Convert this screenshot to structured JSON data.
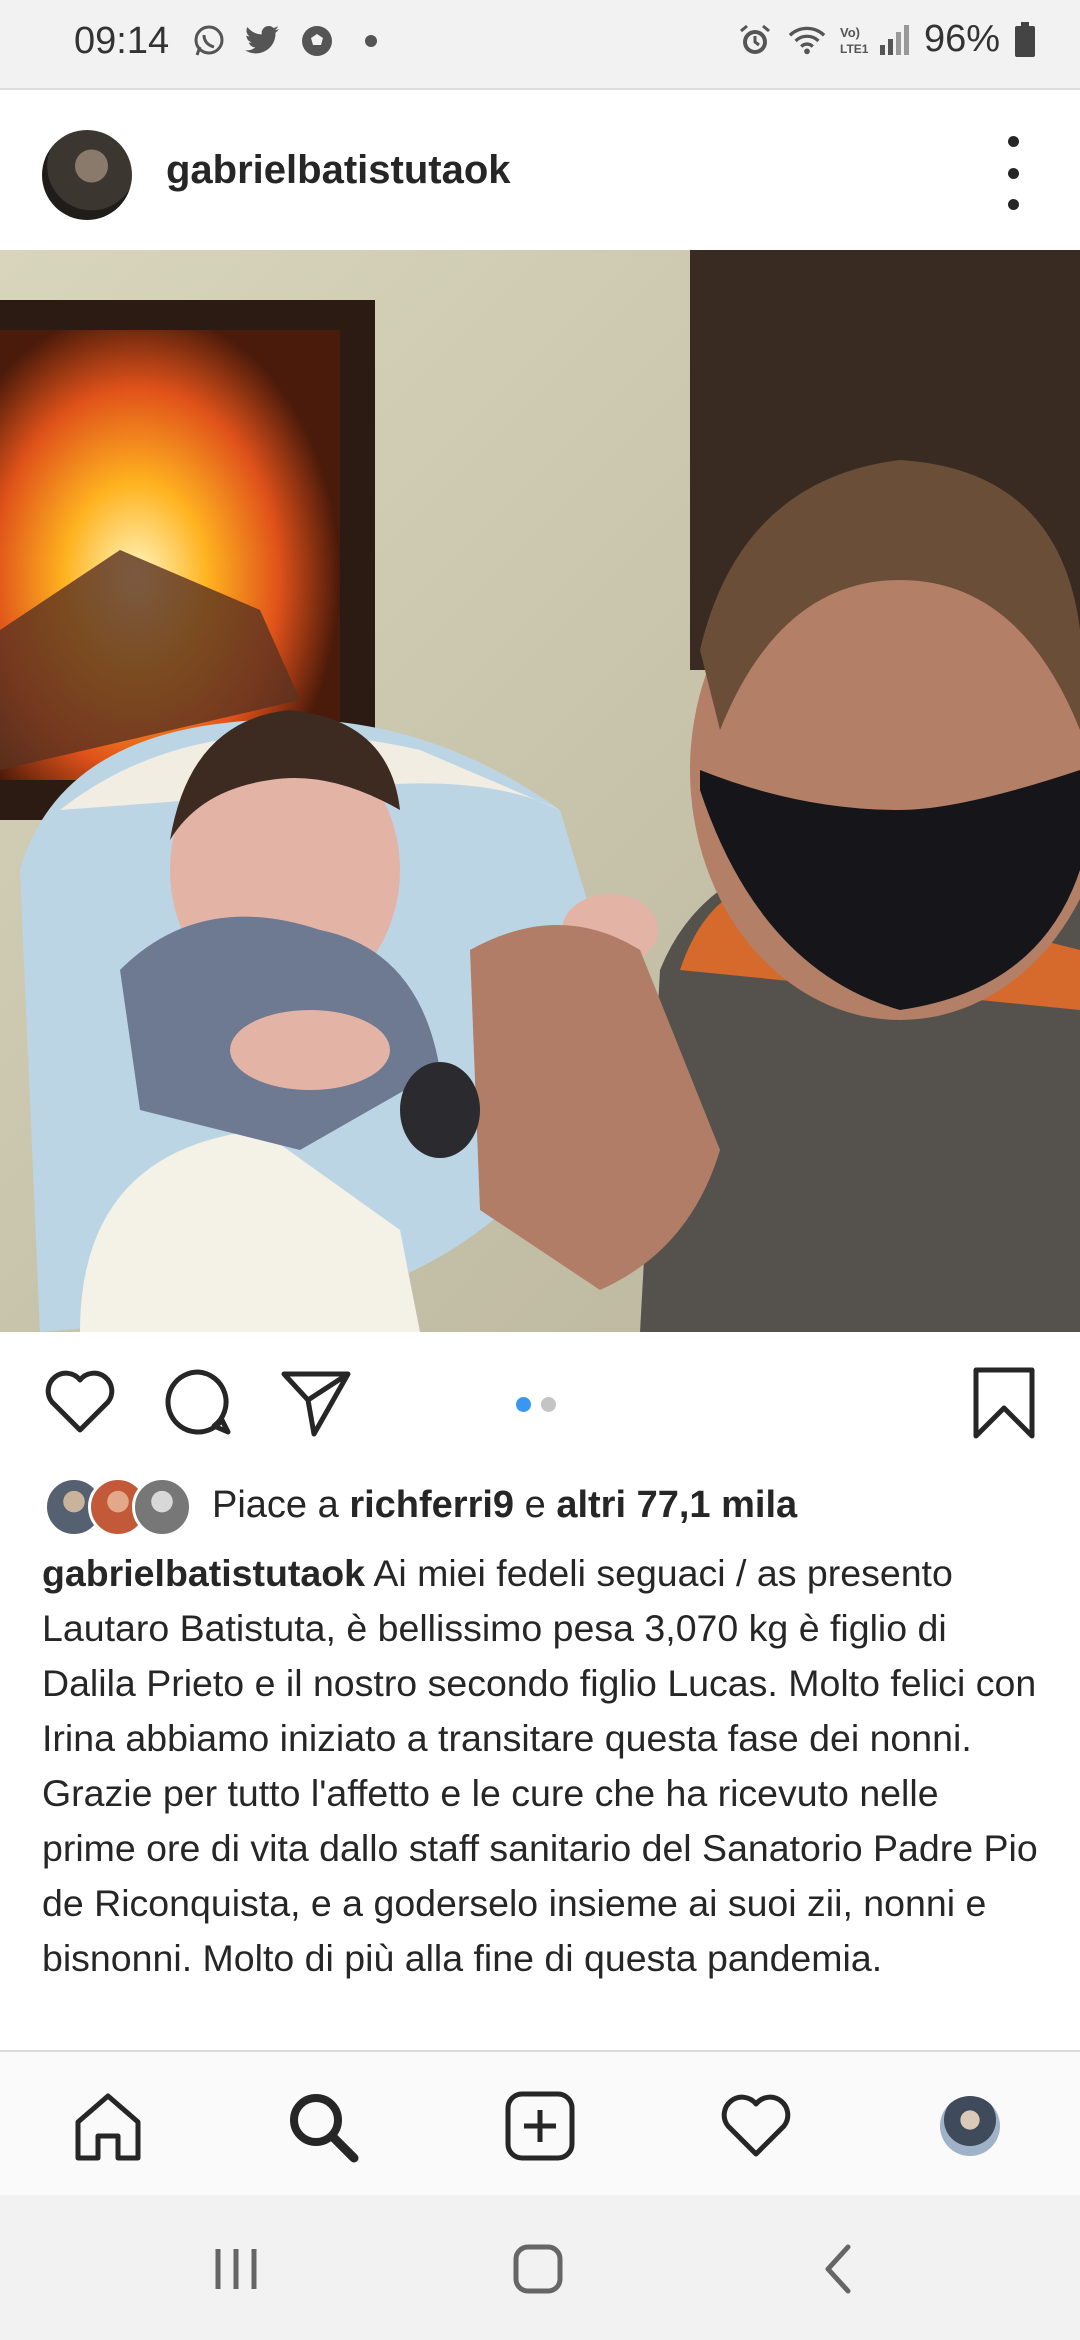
{
  "status_bar": {
    "time": "09:14",
    "battery": "96%",
    "left_icons": [
      "whatsapp-icon",
      "twitter-icon",
      "soccer-ball-icon",
      "dot-icon"
    ],
    "right_icons": [
      "alarm-icon",
      "wifi-icon",
      "volte-signal-icon",
      "battery-icon"
    ]
  },
  "post": {
    "username": "gabrielbatistutaok",
    "photo": "selfie of man in face mask holding newborn baby beside fireplace",
    "carousel": {
      "count": 2,
      "active": 1
    },
    "likes": {
      "prefix": "Piace a",
      "user": "richferri9",
      "middle": "e",
      "others": "altri 77,1 mila"
    },
    "caption": {
      "author": "gabrielbatistutaok",
      "text": "Ai miei fedeli seguaci / as presento Lautaro Batistuta, è bellissimo pesa 3,070 kg è figlio di Dalila Prieto e il nostro secondo figlio Lucas. Molto felici con Irina abbiamo iniziato a transitare questa fase dei nonni. Grazie per tutto l'affetto e le cure che ha ricevuto nelle prime ore di vita dallo staff sanitario del Sanatorio Padre Pio de Riconquista, e a goderselo insieme ai suoi zii, nonni e bisnonni. Molto di più alla fine di questa pandemia."
    }
  },
  "colors": {
    "accent_blue": "#3897f0",
    "text": "#262626"
  }
}
